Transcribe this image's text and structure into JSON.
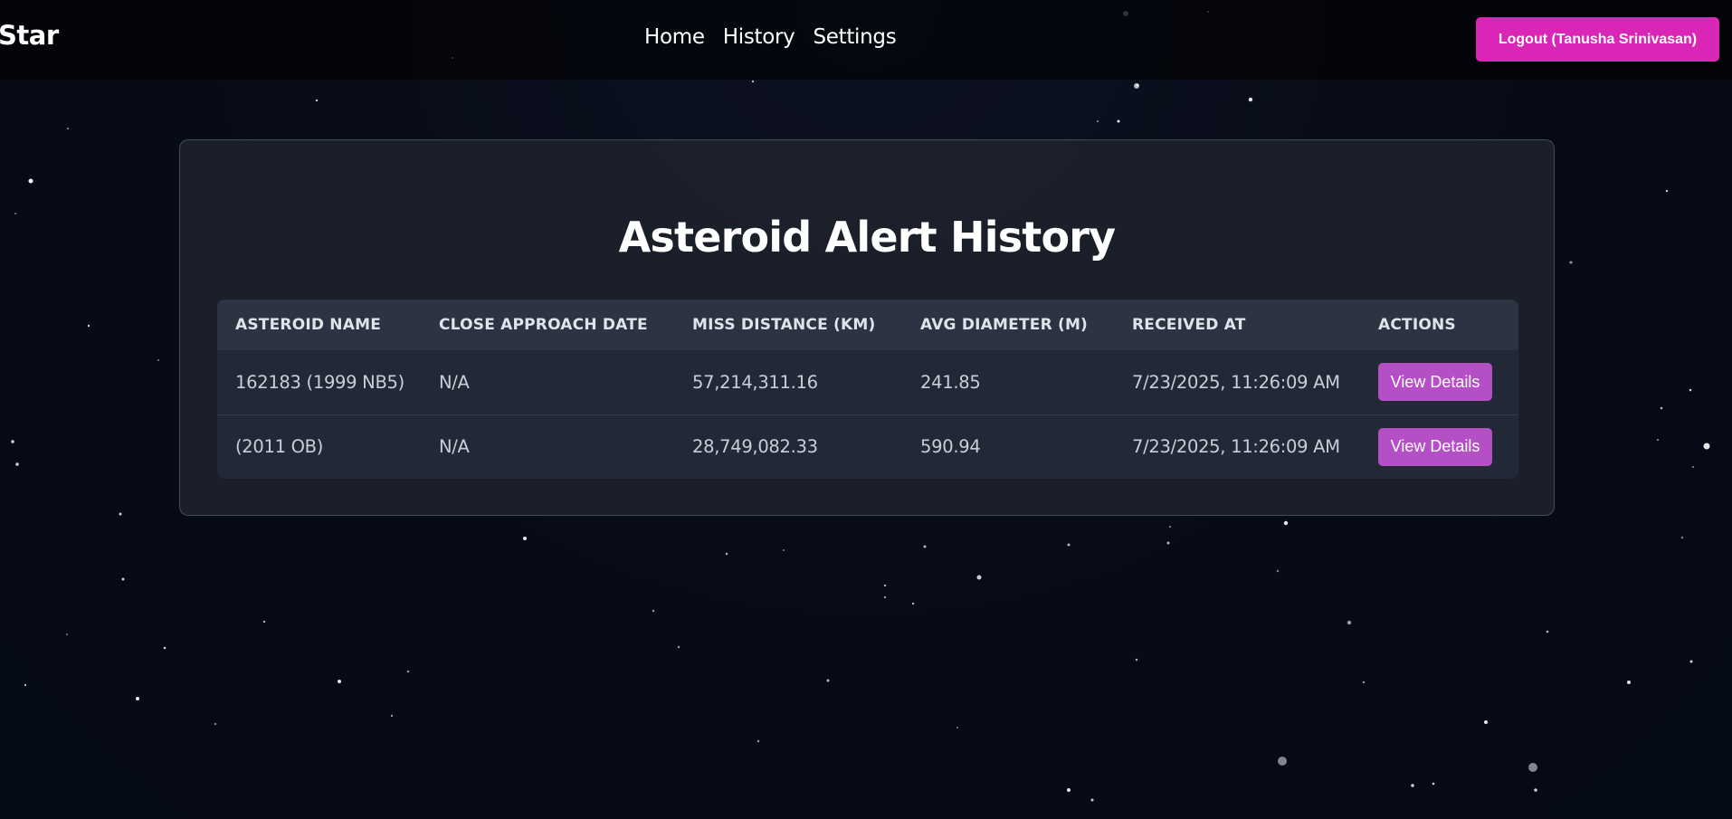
{
  "navbar": {
    "brand": "Star",
    "links": [
      "Home",
      "History",
      "Settings"
    ],
    "logout_label": "Logout (Tanusha Srinivasan)"
  },
  "main": {
    "title": "Asteroid Alert History",
    "table": {
      "headers": [
        "ASTEROID NAME",
        "CLOSE APPROACH DATE",
        "MISS DISTANCE (KM)",
        "AVG DIAMETER (M)",
        "RECEIVED AT",
        "ACTIONS"
      ],
      "rows": [
        {
          "name": "162183 (1999 NB5)",
          "close_approach_date": "N/A",
          "miss_distance": "57,214,311.16",
          "avg_diameter": "241.85",
          "received_at": "7/23/2025, 11:26:09 AM",
          "action_label": "View Details"
        },
        {
          "name": "(2011 OB)",
          "close_approach_date": "N/A",
          "miss_distance": "28,749,082.33",
          "avg_diameter": "590.94",
          "received_at": "7/23/2025, 11:26:09 AM",
          "action_label": "View Details"
        }
      ]
    }
  },
  "colors": {
    "background": "#070b16",
    "accent_logout": "#d926b6",
    "view_button": "#b44fc6",
    "card": "#1e222c",
    "table_header": "#2c3342"
  }
}
